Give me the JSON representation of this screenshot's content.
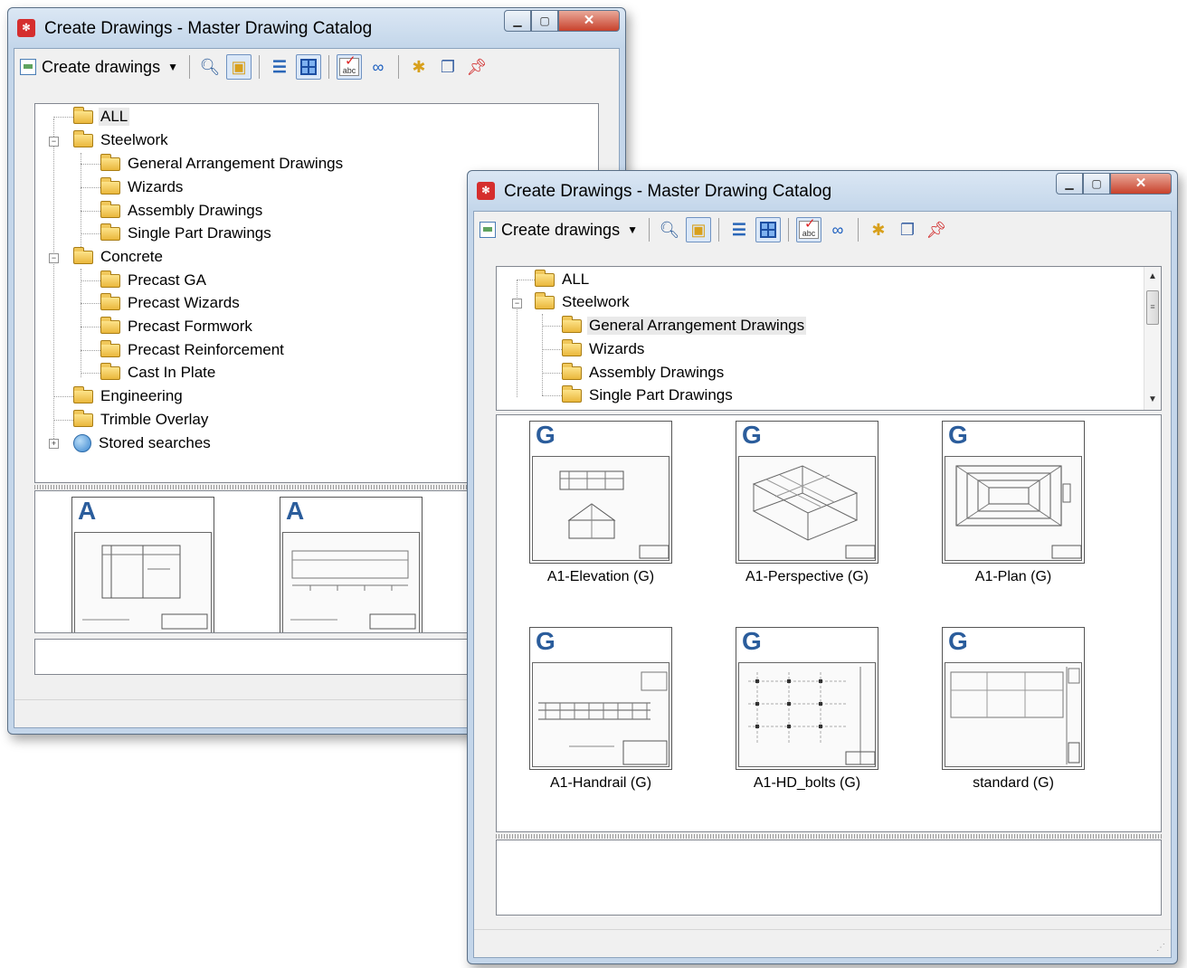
{
  "app": {
    "window_title": "Create Drawings - Master Drawing Catalog",
    "icon_text": "✻"
  },
  "toolbar": {
    "create_label": "Create drawings"
  },
  "window_back": {
    "tree": {
      "all": "ALL",
      "steelwork": "Steelwork",
      "general_arrangement": "General Arrangement Drawings",
      "wizards": "Wizards",
      "assembly": "Assembly Drawings",
      "single_part": "Single Part Drawings",
      "concrete": "Concrete",
      "precast_ga": "Precast GA",
      "precast_wizards": "Precast Wizards",
      "precast_formwork": "Precast Formwork",
      "precast_reinforcement": "Precast Reinforcement",
      "cast_in_plate": "Cast In Plate",
      "engineering": "Engineering",
      "trimble_overlay": "Trimble Overlay",
      "stored_searches": "Stored searches"
    },
    "thumbnails": [
      {
        "letter": "A"
      },
      {
        "letter": "A"
      }
    ]
  },
  "window_front": {
    "tree": {
      "all": "ALL",
      "steelwork": "Steelwork",
      "general_arrangement": "General Arrangement Drawings",
      "wizards": "Wizards",
      "assembly": "Assembly Drawings",
      "single_part": "Single Part Drawings"
    },
    "thumbnails": [
      {
        "letter": "G",
        "caption": "A1-Elevation (G)"
      },
      {
        "letter": "G",
        "caption": "A1-Perspective (G)"
      },
      {
        "letter": "G",
        "caption": "A1-Plan (G)"
      },
      {
        "letter": "G",
        "caption": "A1-Handrail (G)"
      },
      {
        "letter": "G",
        "caption": "A1-HD_bolts (G)"
      },
      {
        "letter": "G",
        "caption": "standard (G)"
      }
    ]
  }
}
